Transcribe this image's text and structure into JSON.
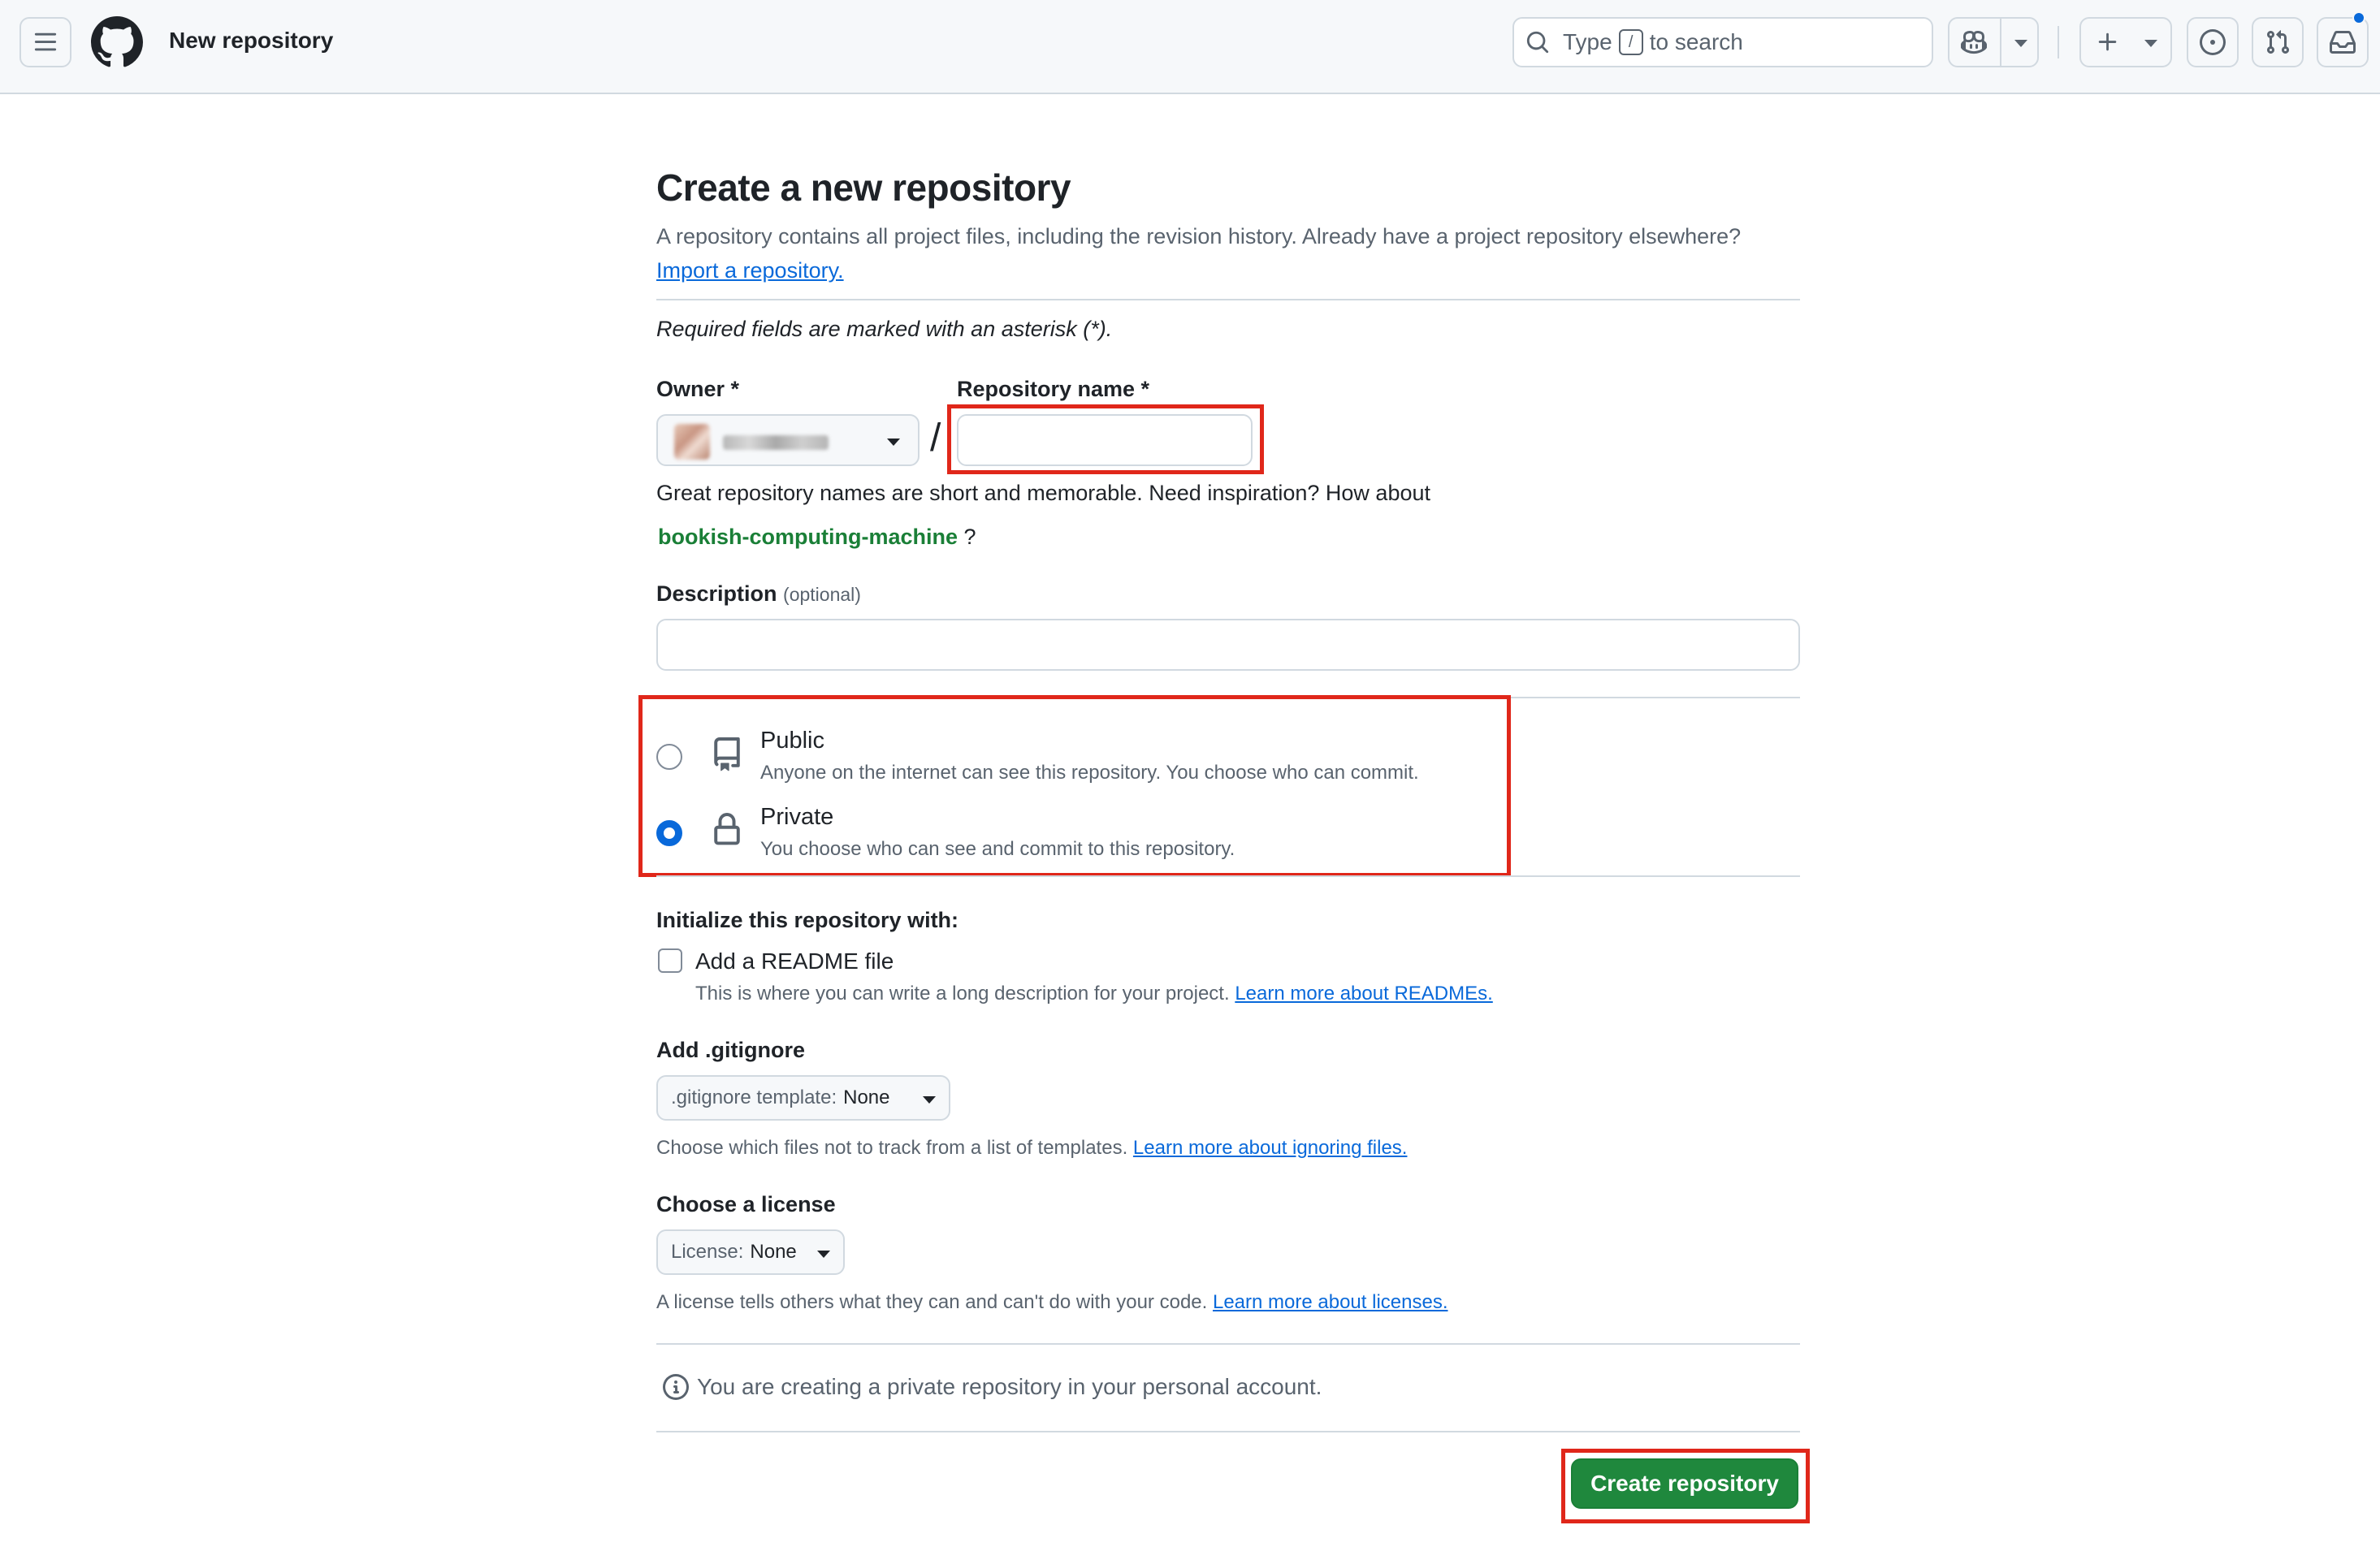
{
  "header": {
    "title": "New repository",
    "search_prefix": "Type",
    "search_key": "/",
    "search_suffix": "to search"
  },
  "main": {
    "heading": "Create a new repository",
    "intro_text": "A repository contains all project files, including the revision history. Already have a project repository elsewhere?",
    "import_link": "Import a repository.",
    "required_note": "Required fields are marked with an asterisk (*).",
    "owner_label": "Owner *",
    "slash": "/",
    "repo_name_label": "Repository name *",
    "repo_name_value": "",
    "name_hint": "Great repository names are short and memorable. Need inspiration? How about",
    "suggested_name": "bookish-computing-machine",
    "suggested_suffix": "?",
    "description_label": "Description",
    "description_optional": "(optional)",
    "description_value": ""
  },
  "visibility": {
    "public_title": "Public",
    "public_desc": "Anyone on the internet can see this repository. You choose who can commit.",
    "private_title": "Private",
    "private_desc": "You choose who can see and commit to this repository.",
    "selected": "Private"
  },
  "initialize": {
    "heading": "Initialize this repository with:",
    "readme_label": "Add a README file",
    "readme_desc": "This is where you can write a long description for your project.",
    "readme_link": "Learn more about READMEs.",
    "readme_checked": false,
    "gitignore_heading": "Add .gitignore",
    "gitignore_select_label": ".gitignore template:",
    "gitignore_select_value": "None",
    "gitignore_desc": "Choose which files not to track from a list of templates.",
    "gitignore_link": "Learn more about ignoring files.",
    "license_heading": "Choose a license",
    "license_select_label": "License:",
    "license_select_value": "None",
    "license_desc": "A license tells others what they can and can't do with your code.",
    "license_link": "Learn more about licenses."
  },
  "footer": {
    "info_text": "You are creating a private repository in your personal account.",
    "create_button": "Create repository"
  },
  "icons": [
    "menu-icon",
    "github-logo-icon",
    "search-icon",
    "copilot-icon",
    "chevron-down-icon",
    "plus-icon",
    "issues-icon",
    "pull-request-icon",
    "inbox-icon",
    "repo-icon",
    "lock-icon",
    "info-icon"
  ],
  "colors": {
    "accent_blue": "#0969da",
    "primary_green": "#1f883d",
    "suggestion_green": "#1a7f37",
    "highlight_red": "#e0271a",
    "header_bg": "#f6f8fa"
  }
}
